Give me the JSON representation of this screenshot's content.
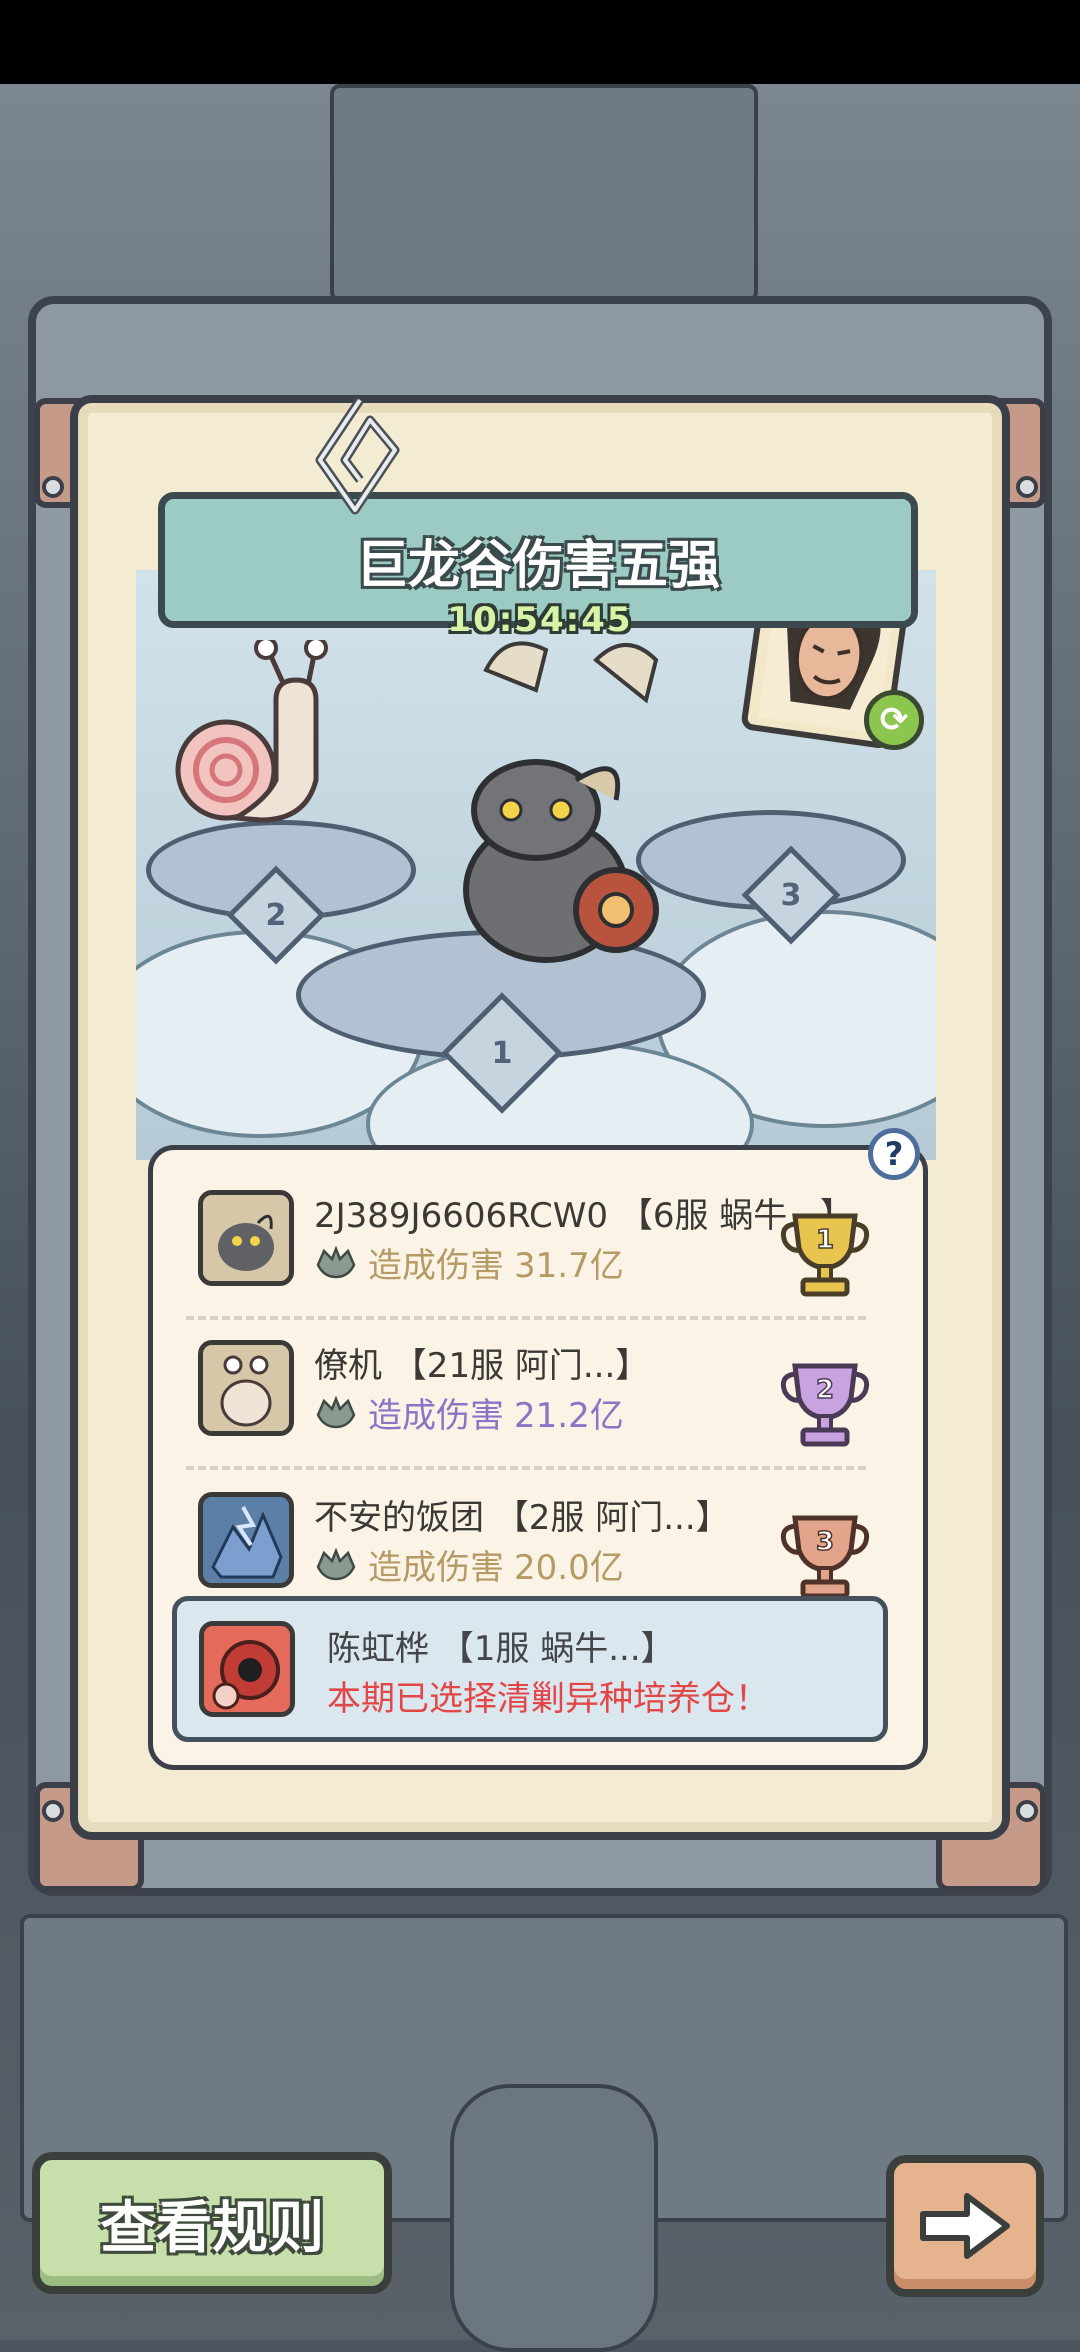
{
  "title": "巨龙谷伤害五强",
  "timer": "10:54:45",
  "podium_numbers": [
    "2",
    "1",
    "3"
  ],
  "help_label": "?",
  "rankings": [
    {
      "rank": "1",
      "name": "2J389J6606RCW0 【6服 蜗牛...】",
      "damage_label": "造成伤害",
      "damage_value": "31.7亿",
      "color": "#b49a64",
      "trophy_color": "#e8c54e"
    },
    {
      "rank": "2",
      "name": "僚机 【21服 阿门...】",
      "damage_label": "造成伤害",
      "damage_value": "21.2亿",
      "color": "#8a74c6",
      "trophy_color": "#c9a2e0"
    },
    {
      "rank": "3",
      "name": "不安的饭团 【2服 阿门...】",
      "damage_label": "造成伤害",
      "damage_value": "20.0亿",
      "color": "#b49a64",
      "trophy_color": "#e2a48a"
    }
  ],
  "self": {
    "name": "陈虹桦 【1服 蜗牛...】",
    "note": "本期已选择清剿异种培养仓！"
  },
  "buttons": {
    "rules": "查看规则",
    "next": "next-arrow-icon"
  }
}
